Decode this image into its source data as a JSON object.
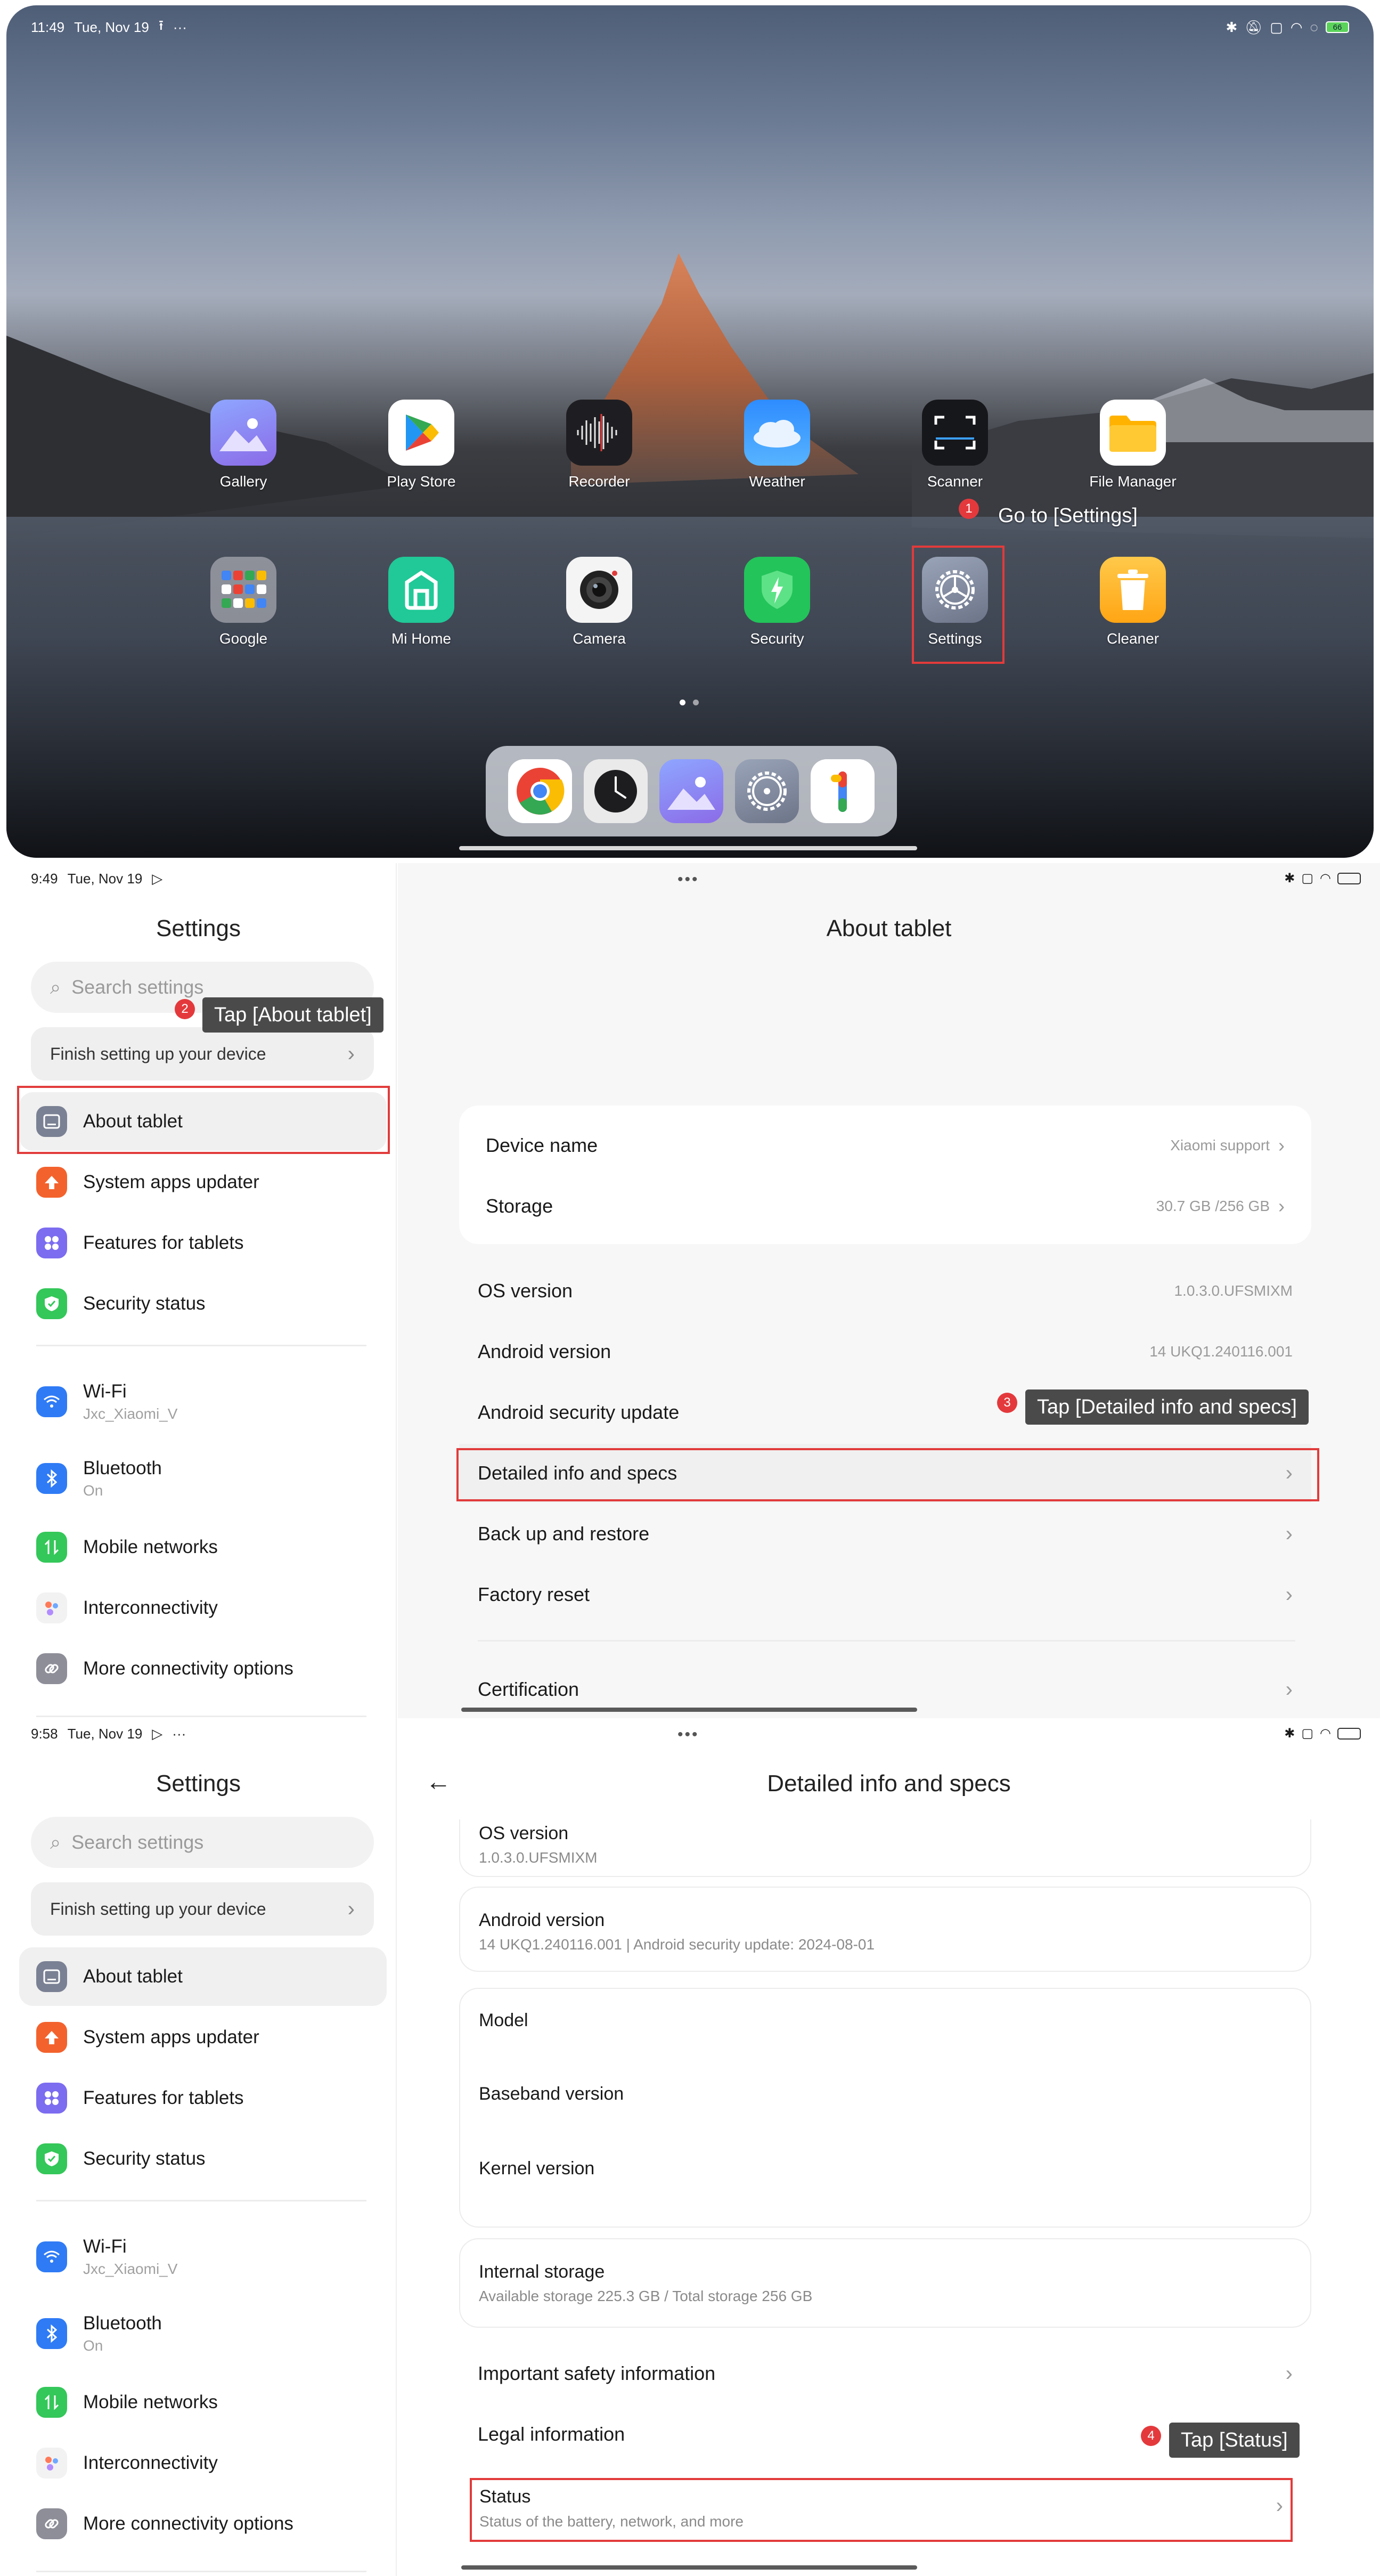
{
  "home": {
    "status": {
      "time": "11:49",
      "date": "Tue, Nov 19",
      "battery": "66"
    },
    "apps_row1": [
      {
        "label": "Gallery",
        "icon": "gallery-icon"
      },
      {
        "label": "Play Store",
        "icon": "play-store-icon"
      },
      {
        "label": "Recorder",
        "icon": "recorder-icon"
      },
      {
        "label": "Weather",
        "icon": "weather-icon"
      },
      {
        "label": "Scanner",
        "icon": "scanner-icon"
      },
      {
        "label": "File Manager",
        "icon": "file-manager-icon"
      }
    ],
    "apps_row2": [
      {
        "label": "Google",
        "icon": "google-folder-icon"
      },
      {
        "label": "Mi Home",
        "icon": "mi-home-icon"
      },
      {
        "label": "Camera",
        "icon": "camera-icon"
      },
      {
        "label": "Security",
        "icon": "security-icon"
      },
      {
        "label": "Settings",
        "icon": "settings-icon"
      },
      {
        "label": "Cleaner",
        "icon": "cleaner-icon"
      }
    ],
    "dock": [
      "chrome-icon",
      "clock-icon",
      "gallery-icon",
      "settings-icon",
      "google-one-icon"
    ],
    "annotation": {
      "number": "1",
      "text": "Go to [Settings]"
    }
  },
  "sidebar": {
    "title": "Settings",
    "search_placeholder": "Search settings",
    "finish_setup": "Finish setting up your device",
    "items_top": [
      {
        "label": "About tablet",
        "icon": "tablet-icon",
        "color": "#7b8194"
      },
      {
        "label": "System apps updater",
        "icon": "arrow-up-icon",
        "color": "#f3622d"
      },
      {
        "label": "Features for tablets",
        "icon": "grid-icon",
        "color": "#7b6cf0"
      },
      {
        "label": "Security status",
        "icon": "shield-check-icon",
        "color": "#34c759"
      }
    ],
    "items_conn": [
      {
        "label": "Wi-Fi",
        "sub": "Jxc_Xiaomi_V",
        "icon": "wifi-icon",
        "color": "#2f7bf5"
      },
      {
        "label": "Bluetooth",
        "sub": "On",
        "icon": "bluetooth-icon",
        "color": "#2f7bf5"
      },
      {
        "label": "Mobile networks",
        "sub": "",
        "icon": "mobile-data-icon",
        "color": "#34c759"
      },
      {
        "label": "Interconnectivity",
        "sub": "",
        "icon": "interconnect-icon",
        "color": "#eeeeee"
      },
      {
        "label": "More connectivity options",
        "sub": "",
        "icon": "link-icon",
        "color": "#8e8e99"
      }
    ]
  },
  "about": {
    "status": {
      "time": "9:49",
      "date": "Tue, Nov 19"
    },
    "title": "About tablet",
    "device_name_label": "Device name",
    "device_name_value": "Xiaomi support",
    "storage_label": "Storage",
    "storage_value": "30.7 GB /256 GB",
    "os_label": "OS version",
    "os_value": "1.0.3.0.UFSMIXM",
    "android_label": "Android version",
    "android_value": "14 UKQ1.240116.001",
    "security_update_label": "Android security update",
    "detailed_label": "Detailed info and specs",
    "backup_label": "Back up and restore",
    "factory_label": "Factory reset",
    "cert_label": "Certification",
    "annotation2": {
      "number": "2",
      "text": "Tap [About tablet]"
    },
    "annotation3": {
      "number": "3",
      "text": "Tap [Detailed info and specs]"
    }
  },
  "detailed": {
    "status": {
      "time": "9:58",
      "date": "Tue, Nov 19"
    },
    "title": "Detailed info and specs",
    "os_label": "OS version",
    "os_value": "1.0.3.0.UFSMIXM",
    "android_label": "Android version",
    "android_value": "14 UKQ1.240116.001 | Android security update: 2024-08-01",
    "model_label": "Model",
    "baseband_label": "Baseband version",
    "kernel_label": "Kernel version",
    "internal_label": "Internal storage",
    "internal_value": "Available storage  225.3 GB / Total storage  256 GB",
    "safety_label": "Important safety information",
    "legal_label": "Legal information",
    "status_label": "Status",
    "status_sub": "Status of the battery, network, and more",
    "annotation4": {
      "number": "4",
      "text": "Tap [Status]"
    }
  }
}
